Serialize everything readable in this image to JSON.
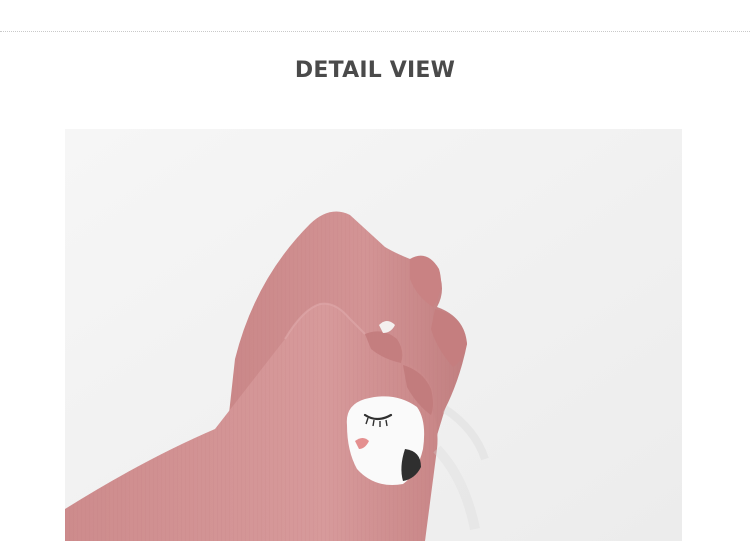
{
  "section": {
    "title": "DETAIL VIEW"
  },
  "photo": {
    "subject": "pink-sock-icon",
    "colors": {
      "background": "#f3f3f3",
      "sock_main": "#cf8f90",
      "sock_shadow": "#b97879",
      "sock_light": "#dba1a1",
      "face_white": "#fafafa",
      "face_dark": "#2f2f2f",
      "nose": "#e48f8f"
    }
  }
}
